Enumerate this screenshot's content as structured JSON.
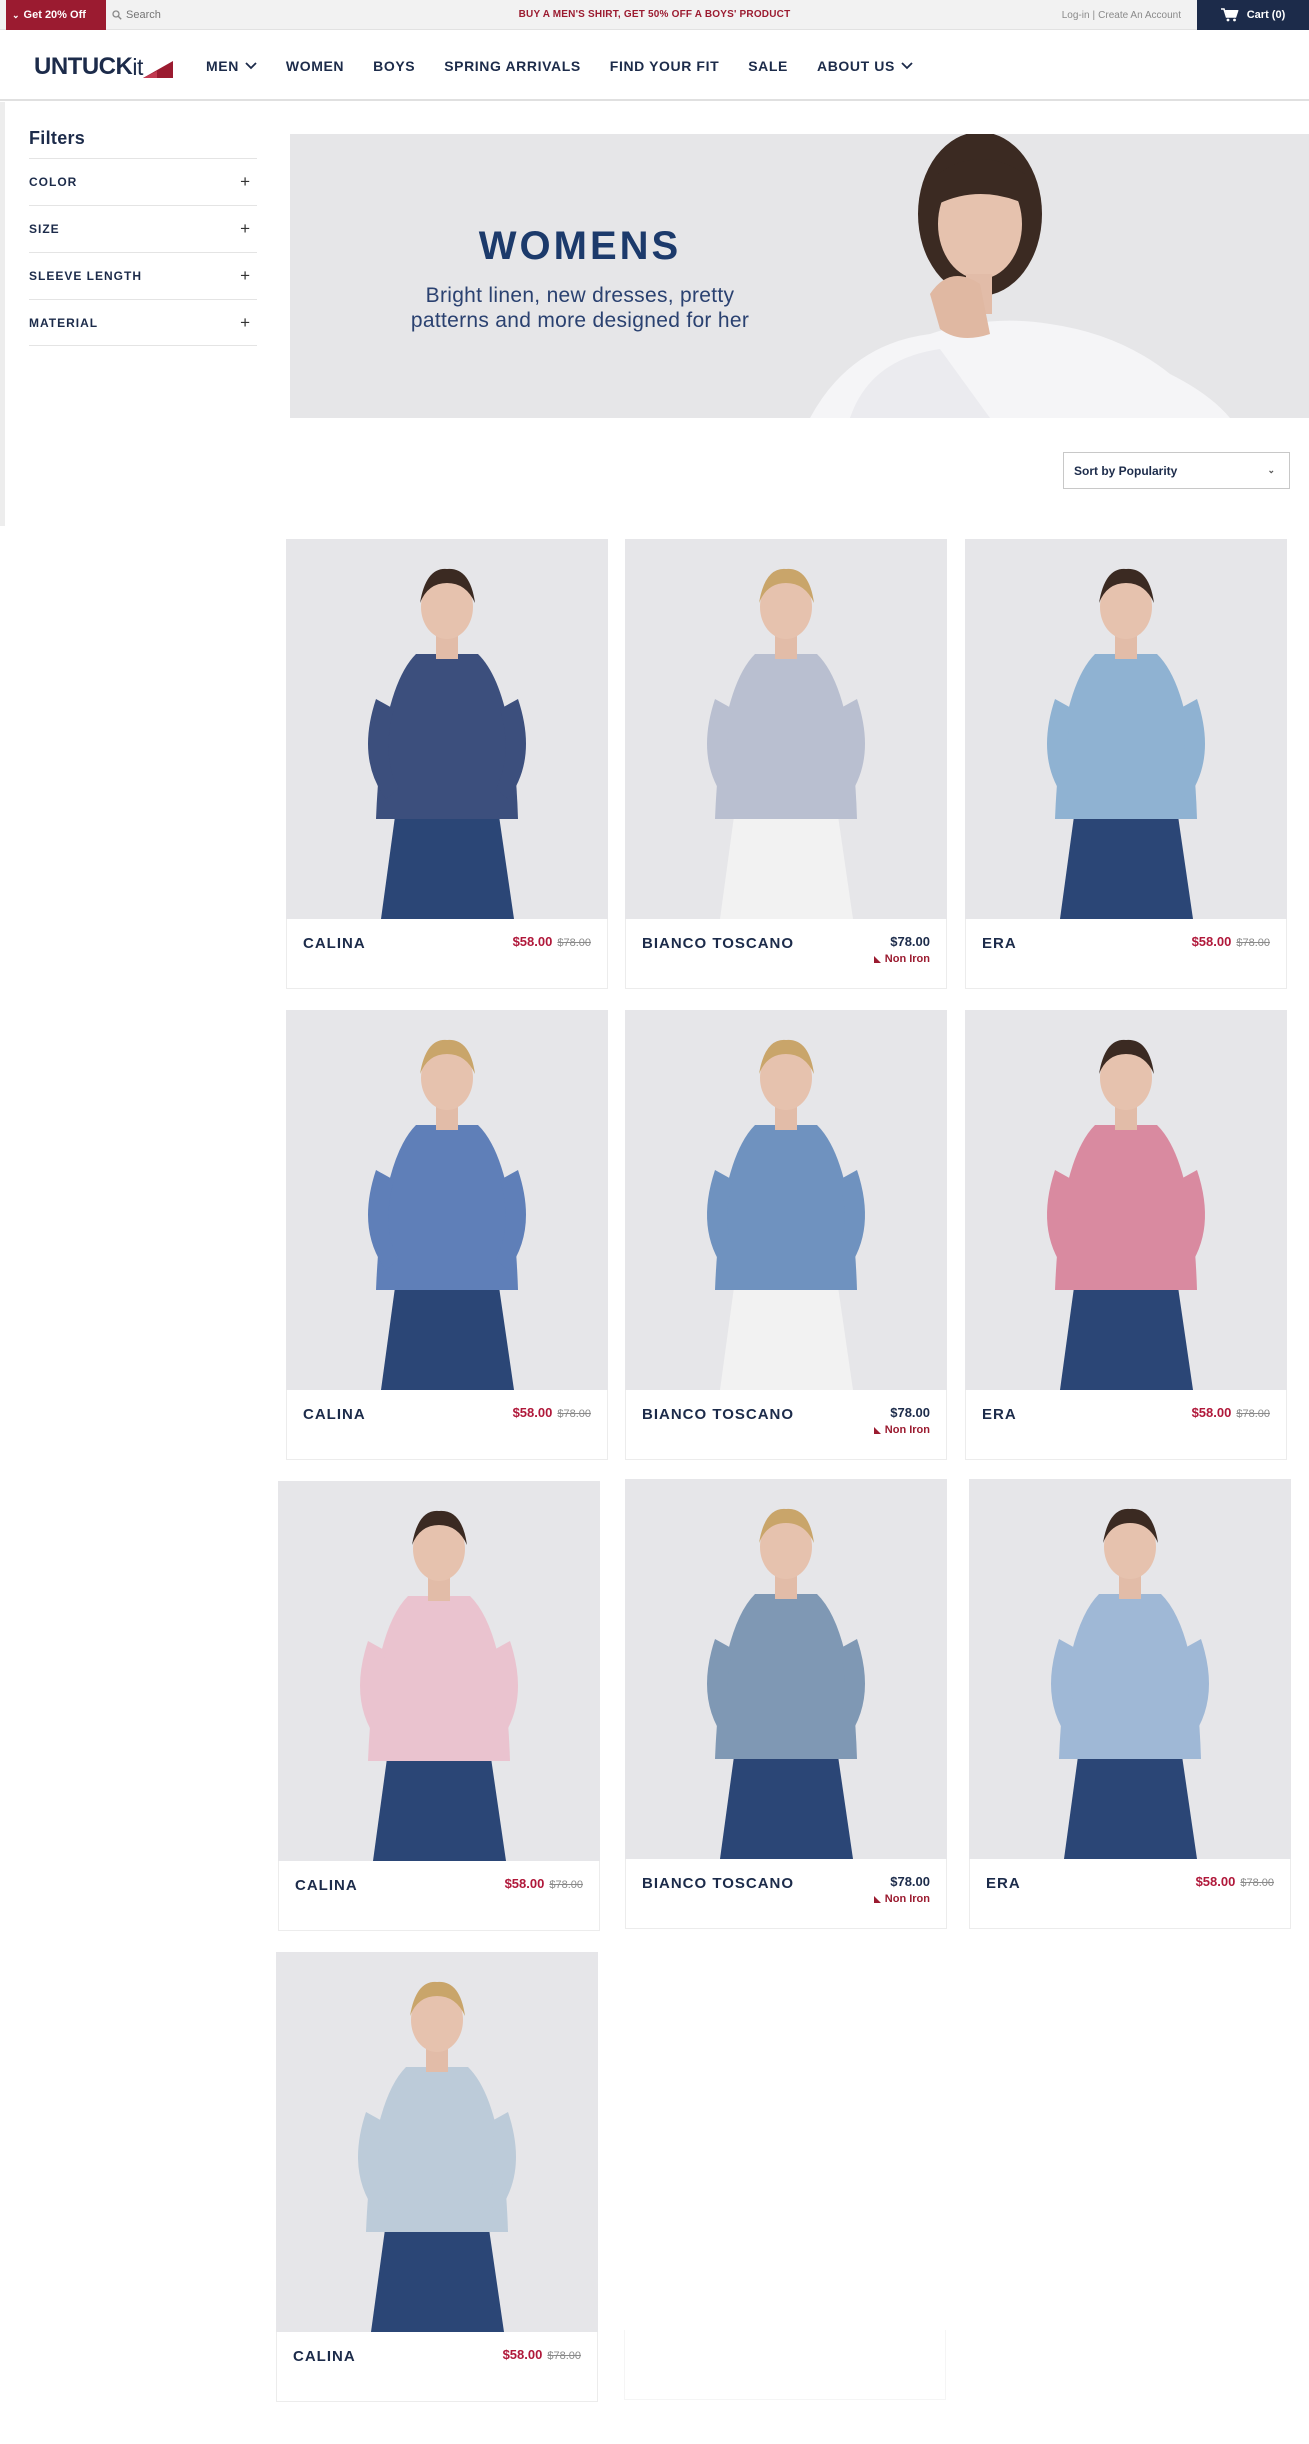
{
  "topbar": {
    "promo_label": "Get 20% Off",
    "search_placeholder": "Search",
    "message": "BUY A MEN'S SHIRT, GET 50% OFF A BOYS' PRODUCT",
    "login": "Log-in",
    "separator": "|",
    "create_account": "Create An Account",
    "cart": "Cart (0)"
  },
  "nav": {
    "logo_main": "UNTUCK",
    "logo_it": "it",
    "items": [
      "MEN",
      "WOMEN",
      "BOYS",
      "SPRING ARRIVALS",
      "FIND YOUR FIT",
      "SALE",
      "ABOUT US"
    ]
  },
  "sidebar": {
    "title": "Filters",
    "filters": [
      "COLOR",
      "SIZE",
      "SLEEVE LENGTH",
      "MATERIAL"
    ]
  },
  "hero": {
    "title": "WOMENS",
    "subtitle_line1": "Bright linen, new dresses, pretty",
    "subtitle_line2": "patterns and more designed for her"
  },
  "sort": {
    "label": "Sort by Popularity"
  },
  "products": [
    {
      "name": "CALINA",
      "price": "$58.00",
      "original": "$78.00",
      "badge": "",
      "swatch": "#3c4f7d"
    },
    {
      "name": "BIANCO TOSCANO",
      "price": "$78.00",
      "original": "",
      "badge": "Non Iron",
      "swatch": "#b9bfd0"
    },
    {
      "name": "ERA",
      "price": "$58.00",
      "original": "$78.00",
      "badge": "",
      "swatch": "#8fb2d2"
    },
    {
      "name": "CALINA",
      "price": "$58.00",
      "original": "$78.00",
      "badge": "",
      "swatch": "#5f7fb8"
    },
    {
      "name": "BIANCO TOSCANO",
      "price": "$78.00",
      "original": "",
      "badge": "Non Iron",
      "swatch": "#6f92bf"
    },
    {
      "name": "ERA",
      "price": "$58.00",
      "original": "$78.00",
      "badge": "",
      "swatch": "#d98aa0"
    },
    {
      "name": "CALINA",
      "price": "$58.00",
      "original": "$78.00",
      "badge": "",
      "swatch": "#eac3cf"
    },
    {
      "name": "BIANCO TOSCANO",
      "price": "$78.00",
      "original": "",
      "badge": "Non Iron",
      "swatch": "#7f98b4"
    },
    {
      "name": "ERA",
      "price": "$58.00",
      "original": "$78.00",
      "badge": "",
      "swatch": "#9fb8d6"
    },
    {
      "name": "CALINA",
      "price": "$58.00",
      "original": "$78.00",
      "badge": "",
      "swatch": "#bccbd9"
    }
  ],
  "colors": {
    "brand_navy": "#1c2b4a",
    "brand_red": "#9b1b30",
    "sale_red": "#b0183a"
  }
}
